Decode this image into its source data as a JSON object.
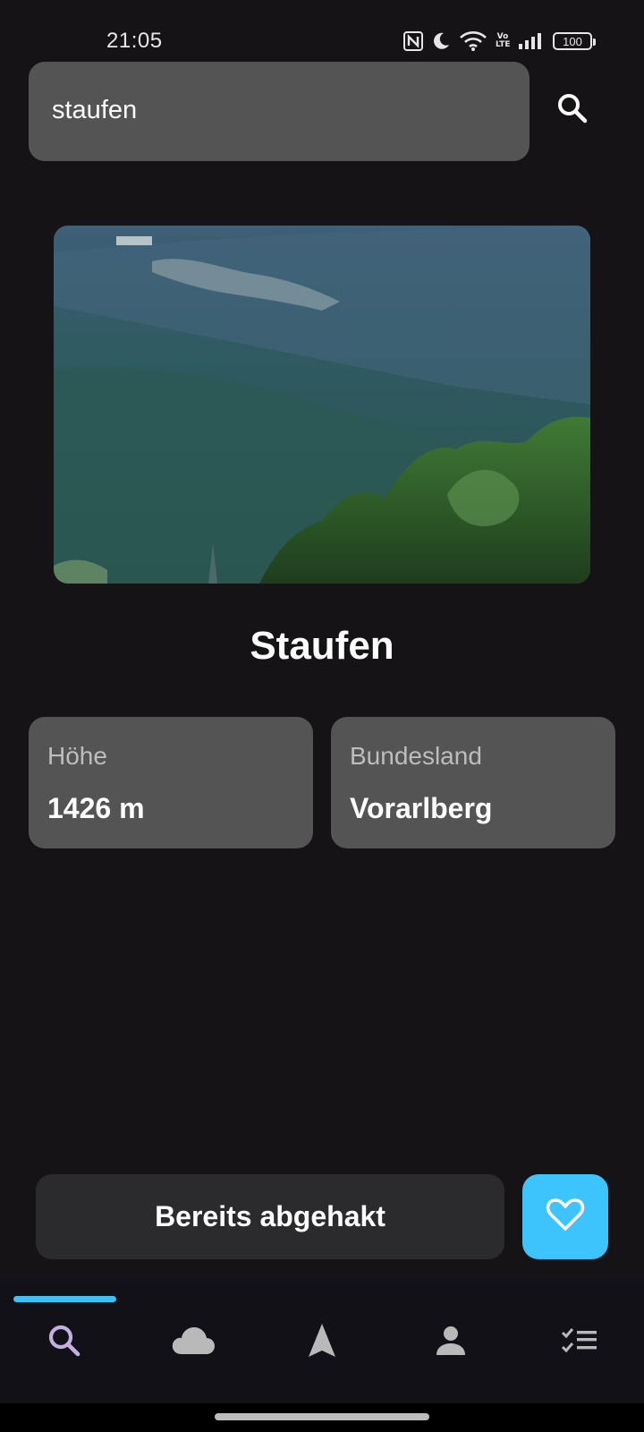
{
  "status_bar": {
    "time": "21:05",
    "network_label": "Vo LTE",
    "battery": "100",
    "icons": [
      "nfc-icon",
      "moon-icon",
      "wifi-icon",
      "volte-icon",
      "signal-icon",
      "battery-icon"
    ]
  },
  "search": {
    "value": "staufen",
    "icon": "search-icon"
  },
  "mountain": {
    "name": "Staufen",
    "height_label": "Höhe",
    "height_value": "1426 m",
    "state_label": "Bundesland",
    "state_value": "Vorarlberg"
  },
  "actions": {
    "checked_label": "Bereits abgehakt",
    "favorite_icon": "heart-icon"
  },
  "nav": {
    "items": [
      "search-icon",
      "cloud-icon",
      "navigation-arrow-icon",
      "person-icon",
      "checklist-icon"
    ],
    "active": "search-icon"
  },
  "colors": {
    "background": "#151316",
    "card": "#545454",
    "accent": "#3ec4fc",
    "nav_active_icon": "#c4b0e0"
  }
}
